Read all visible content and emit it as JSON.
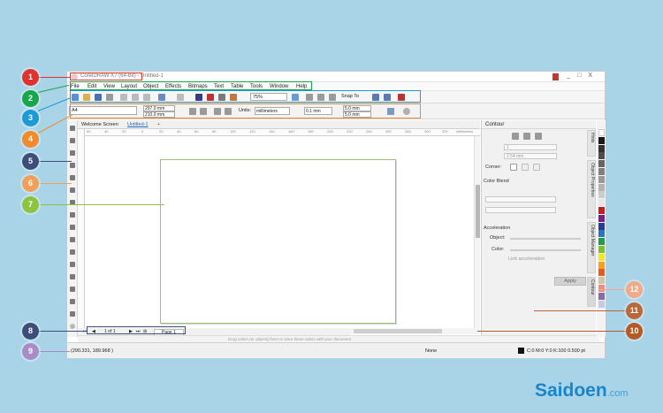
{
  "window": {
    "title": "CorelDRAW X7 (64-Bit) - Untitled-1",
    "controls": [
      "_",
      "□",
      "X"
    ]
  },
  "menu": [
    "File",
    "Edit",
    "View",
    "Layout",
    "Object",
    "Effects",
    "Bitmaps",
    "Text",
    "Table",
    "Tools",
    "Window",
    "Help"
  ],
  "toolbar": {
    "zoom": "75%",
    "snap_to": "Snap To"
  },
  "property_bar": {
    "page_size": "A4",
    "width": "297.0 mm",
    "height": "210.0 mm",
    "units_label": "Units:",
    "units_value": "millimeters",
    "nudge": "0.1 mm",
    "dup_x": "5.0 mm",
    "dup_y": "5.0 mm"
  },
  "tabs": [
    "Welcome Screen",
    "Untitled-1"
  ],
  "ruler": {
    "ticks": [
      "60",
      "40",
      "20",
      "0",
      "20",
      "40",
      "60",
      "80",
      "100",
      "120",
      "140",
      "160",
      "180",
      "200",
      "220",
      "240",
      "260",
      "280",
      "300",
      "320"
    ],
    "unit": "millimeters"
  },
  "page_nav": {
    "counter": "1 of 1",
    "page_tab": "Page 1"
  },
  "color_strip_hint": "Drag colors (or objects) here to store these colors with your document",
  "status": {
    "coords": "(290.331, 189.968 )",
    "fill": "None",
    "outline": "C:0 M:0 Y:0 K:100  0.500 pt"
  },
  "docker": {
    "title": "Contour",
    "steps": "1",
    "offset": "2.54 mm",
    "corner_label": "Corner:",
    "color_blend_label": "Color Blend",
    "acceleration_label": "Acceleration",
    "object_label": "Object:",
    "color_label": "Color:",
    "link_label": "Link acceleration",
    "apply_label": "Apply"
  },
  "side_tabs": [
    "Hints",
    "Object Properties",
    "Object Manager",
    "Contour"
  ],
  "palette_colors": [
    "#ffffff",
    "#1a1a1a",
    "#333333",
    "#4d4d4d",
    "#666666",
    "#808080",
    "#999999",
    "#b3b3b3",
    "#cccccc",
    "#e6e6e6",
    "#c71e1e",
    "#7a1e8c",
    "#2a3a9c",
    "#1f7ac0",
    "#1e9e4a",
    "#78c22a",
    "#f6e71a",
    "#f5a11c",
    "#e65c1a",
    "#d4c5a0",
    "#f08a8a",
    "#8a6aa8",
    "#c8c8e8"
  ],
  "callouts": [
    "1",
    "2",
    "3",
    "4",
    "5",
    "6",
    "7",
    "8",
    "9",
    "10",
    "11",
    "12"
  ],
  "callout_colors": {
    "c1": "#e0322f",
    "c2": "#18a64a",
    "c3": "#1b9ad6",
    "c4": "#f08a2c",
    "c5": "#3d4f78",
    "c6": "#f0a05a",
    "c7": "#8cc43f",
    "c8": "#3d4f78",
    "c9": "#a98bc7",
    "c10": "#b45a28",
    "c11": "#b8683a",
    "c12": "#f1a98a"
  },
  "brand": {
    "name": "Saidoen",
    "suffix": ".com"
  }
}
